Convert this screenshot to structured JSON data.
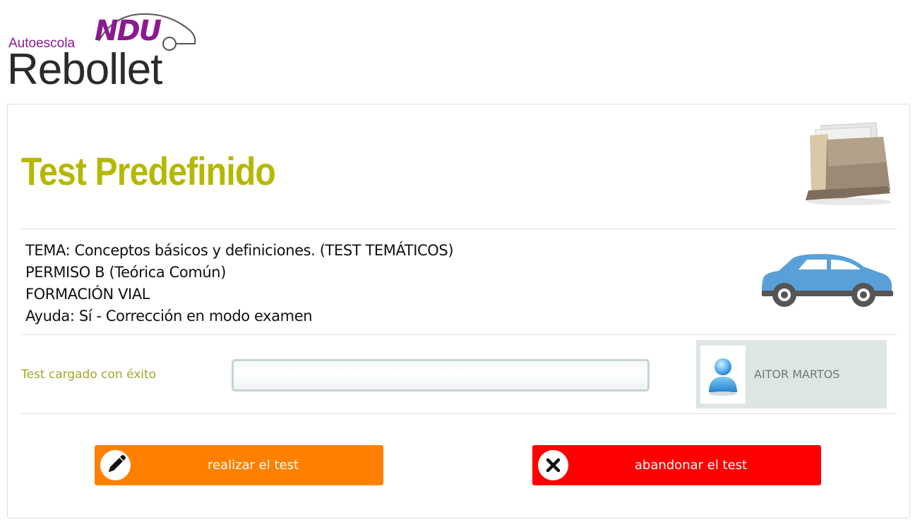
{
  "logo": {
    "brand_mark": "NDU",
    "line1": "Autoescola",
    "line2": "Rebollet"
  },
  "header": {
    "title": "Test Predefinido"
  },
  "info": {
    "lines": [
      "TEMA: Conceptos básicos y definiciones. (TEST TEMÁTICOS)",
      "PERMISO B (Teórica Común)",
      "FORMACIÓN VIAL",
      "Ayuda: Sí - Corrección en modo examen"
    ]
  },
  "status": {
    "message": "Test cargado con éxito",
    "progress_fraction": 0
  },
  "user": {
    "name": "AITOR MARTOS",
    "avatar_icon": "user-avatar-icon"
  },
  "buttons": {
    "start": {
      "label": "realizar el test",
      "icon": "pencil-icon",
      "color": "#ff8000"
    },
    "abandon": {
      "label": "abandonar el test",
      "icon": "close-icon",
      "color": "#ff0000"
    }
  },
  "colors": {
    "title": "#b5b800",
    "status": "#a3a629",
    "brand": "#8b1a8f",
    "car": "#5aa0d8"
  }
}
